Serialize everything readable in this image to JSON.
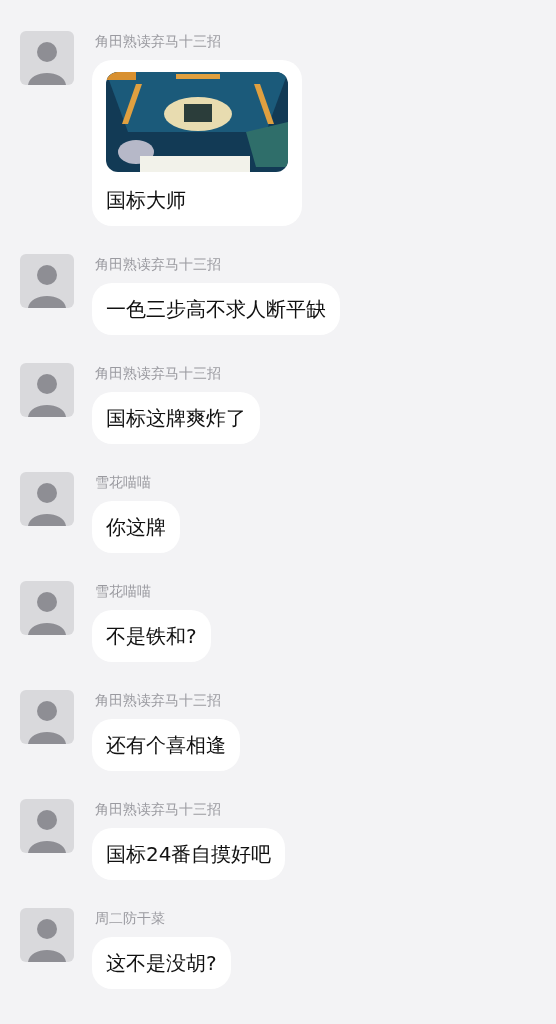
{
  "messages": [
    {
      "sender": "角田熟读弃马十三招",
      "text": "国标大师"
    },
    {
      "sender": "角田熟读弃马十三招",
      "text": "一色三步高不求人断平缺"
    },
    {
      "sender": "角田熟读弃马十三招",
      "text": "国标这牌爽炸了"
    },
    {
      "sender": "雪花喵喵",
      "text": "你这牌"
    },
    {
      "sender": "雪花喵喵",
      "text": "不是铁和?"
    },
    {
      "sender": "角田熟读弃马十三招",
      "text": "还有个喜相逢"
    },
    {
      "sender": "角田熟读弃马十三招",
      "text": "国标24番自摸好吧"
    },
    {
      "sender": "周二防干菜",
      "text": "这不是没胡?"
    }
  ]
}
